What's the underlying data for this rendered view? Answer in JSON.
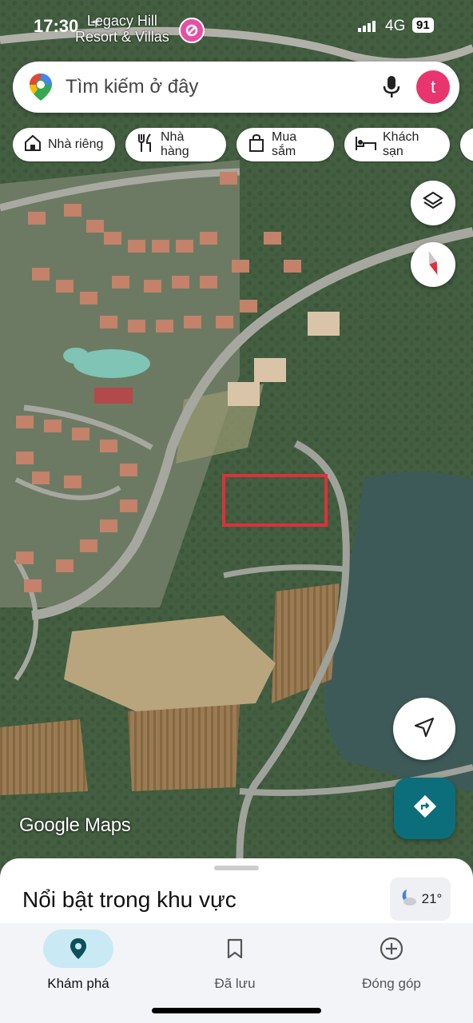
{
  "status_bar": {
    "time": "17:30",
    "place_line1": "Legacy Hill",
    "place_line2": "Resort & Villas",
    "network": "4G",
    "battery": "91"
  },
  "search": {
    "placeholder": "Tìm kiếm ở đây",
    "avatar_letter": "t"
  },
  "chips": [
    {
      "label": "Nhà riêng",
      "icon": "home-icon"
    },
    {
      "label": "Nhà hàng",
      "icon": "restaurant-icon"
    },
    {
      "label": "Mua sắm",
      "icon": "shopping-bag-icon"
    },
    {
      "label": "Khách sạn",
      "icon": "hotel-icon"
    }
  ],
  "map": {
    "watermark": "Google Maps",
    "mode": "satellite",
    "highlight_color": "#e0303a"
  },
  "sheet": {
    "title": "Nổi bật trong khu vực",
    "temperature": "21°"
  },
  "bottom_nav": [
    {
      "label": "Khám phá",
      "icon": "explore-pin-icon",
      "active": true
    },
    {
      "label": "Đã lưu",
      "icon": "bookmark-icon",
      "active": false
    },
    {
      "label": "Đóng góp",
      "icon": "add-circle-icon",
      "active": false
    }
  ],
  "colors": {
    "accent": "#0d6e7b",
    "avatar": "#e8356f",
    "active_nav_bg": "#c9eaf4"
  }
}
